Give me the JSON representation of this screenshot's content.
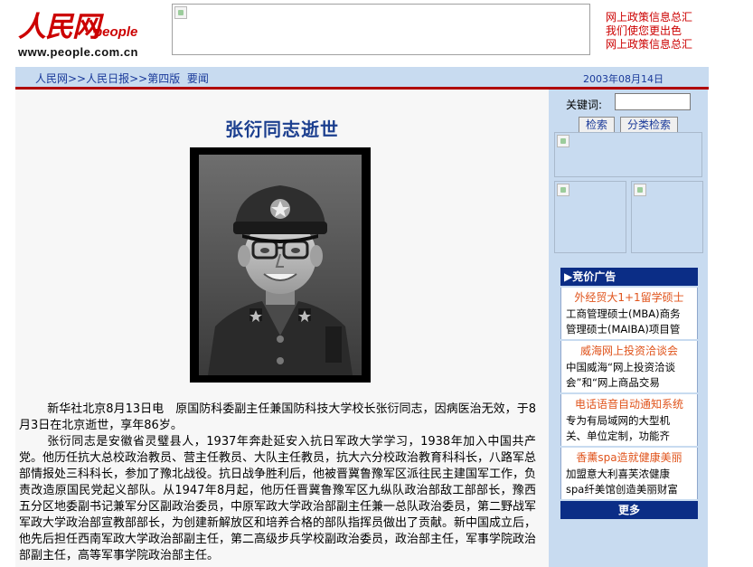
{
  "header": {
    "logo_cn": "人民网",
    "logo_en": "people",
    "logo_url": "www.people.com.cn",
    "promo_links": [
      "网上政策信息总汇",
      "我们使您更出色",
      "网上政策信息总汇"
    ]
  },
  "nav": {
    "crumbs": [
      "人民网>>",
      "人民日报>>",
      "第四版",
      "要闻"
    ],
    "date": "2003年08月14日"
  },
  "article": {
    "title": "张衍同志逝世",
    "paragraphs": [
      "新华社北京8月13日电　原国防科委副主任兼国防科技大学校长张衍同志，因病医治无效，于8月3日在北京逝世，享年86岁。",
      "张衍同志是安徽省灵璧县人，1937年奔赴延安入抗日军政大学学习，1938年加入中国共产党。他历任抗大总校政治教员、营主任教员、大队主任教员，抗大六分校政治教育科科长，八路军总部情报处三科科长，参加了豫北战役。抗日战争胜利后，他被晋冀鲁豫军区派往民主建国军工作，负责改造原国民党起义部队。从1947年8月起，他历任晋冀鲁豫军区九纵队政治部敌工部部长，豫西五分区地委副书记兼军分区副政治委员，中原军政大学政治部副主任兼一总队政治委员，第二野战军军政大学政治部宣教部部长，为创建新解放区和培养合格的部队指挥员做出了贡献。新中国成立后，他先后担任西南军政大学政治部副主任，第二高级步兵学校副政治委员，政治部主任，军事学院政治部副主任，高等军事学院政治部主任。"
    ]
  },
  "search": {
    "label": "关键词:",
    "value": "",
    "search_btn": "检索",
    "category_btn": "分类检索"
  },
  "ads": {
    "heading": "▶竞价广告",
    "items": [
      {
        "title": "外经贸大1+1留学硕士",
        "lines": [
          "工商管理硕士(MBA)商务",
          "管理硕士(MAIBA)项目管"
        ]
      },
      {
        "title": "威海网上投资洽谈会",
        "lines": [
          "中国威海“网上投资洽谈",
          "会”和“网上商品交易"
        ]
      },
      {
        "title": "电话语音自动通知系统",
        "lines": [
          "专为有局域网的大型机",
          "关、单位定制，功能齐"
        ]
      },
      {
        "title": "香薰spa造就健康美丽",
        "lines": [
          "加盟意大利喜芙浓健康",
          "spa纤美馆创造美丽财富"
        ]
      }
    ],
    "more": "更多"
  },
  "colors": {
    "brand_red": "#cc0000",
    "nav_bg": "#c8dbf0",
    "title_blue": "#1c3f8f",
    "ad_header": "#0b2d86",
    "ad_title": "#e0541c"
  }
}
